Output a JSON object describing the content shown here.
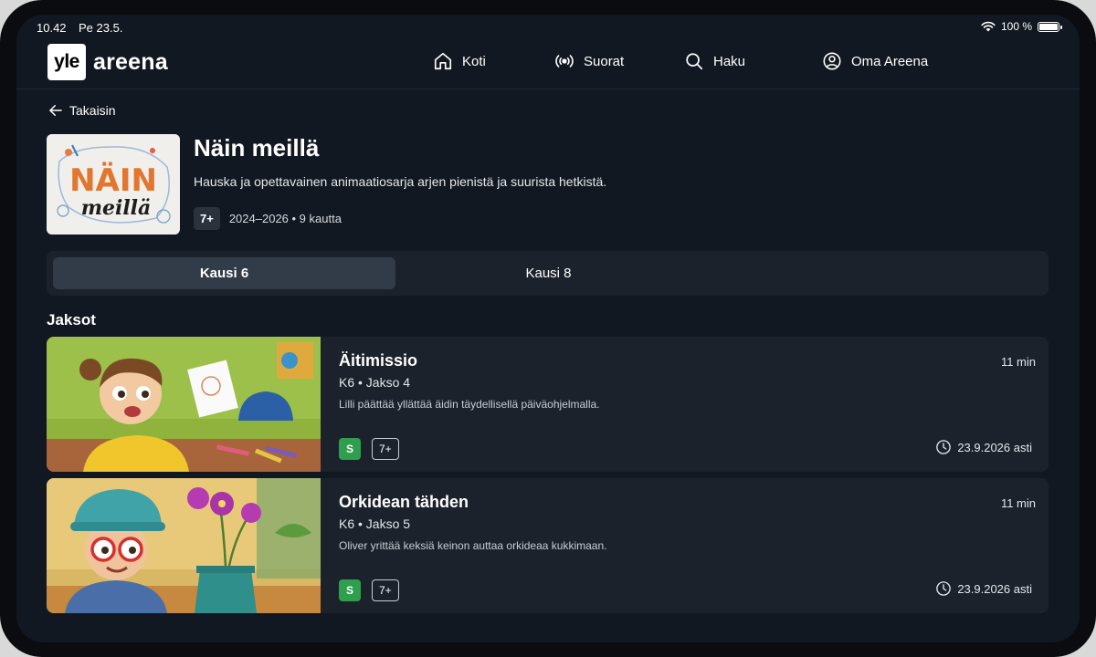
{
  "status_bar": {
    "time": "10.42",
    "date": "Pe 23.5.",
    "battery": "100 %",
    "battery_level": 1.0
  },
  "header": {
    "logo_box": "yle",
    "logo_text": "areena",
    "nav": [
      {
        "label": "Koti",
        "icon": "home-icon"
      },
      {
        "label": "Suorat",
        "icon": "broadcast-icon"
      },
      {
        "label": "Haku",
        "icon": "search-icon"
      },
      {
        "label": "Oma Areena",
        "icon": "user-icon"
      }
    ]
  },
  "back": {
    "label": "Takaisin"
  },
  "show": {
    "title": "Näin meillä",
    "logo_line1": "NÄIN",
    "logo_line2": "meillä",
    "description": "Hauska ja opettavainen animaatiosarja arjen pienistä ja suurista hetkistä.",
    "age_rating": "7+",
    "meta": "2024–2026 • 9 kautta"
  },
  "seasons": [
    {
      "label": "Kausi 6",
      "active": true
    },
    {
      "label": "Kausi 8",
      "active": false
    }
  ],
  "episodes_section": {
    "title": "Jaksot"
  },
  "episodes": [
    {
      "title": "Äitimissio",
      "subtitle": "K6 • Jakso 4",
      "description": "Lilli päättää yllättää äidin täydellisellä päiväohjelmalla.",
      "duration": "11 min",
      "badge_s": "S",
      "age": "7+",
      "available": "23.9.2026 asti"
    },
    {
      "title": "Orkidean tähden",
      "subtitle": "K6 • Jakso 5",
      "description": "Oliver yrittää keksiä keinon auttaa orkideaa kukkimaan.",
      "duration": "11 min",
      "badge_s": "S",
      "age": "7+",
      "available": "23.9.2026 asti"
    }
  ],
  "colors": {
    "background": "#121821",
    "card": "#1b222c",
    "active_tab": "#323b48",
    "badge_green": "#2f9e4d"
  }
}
